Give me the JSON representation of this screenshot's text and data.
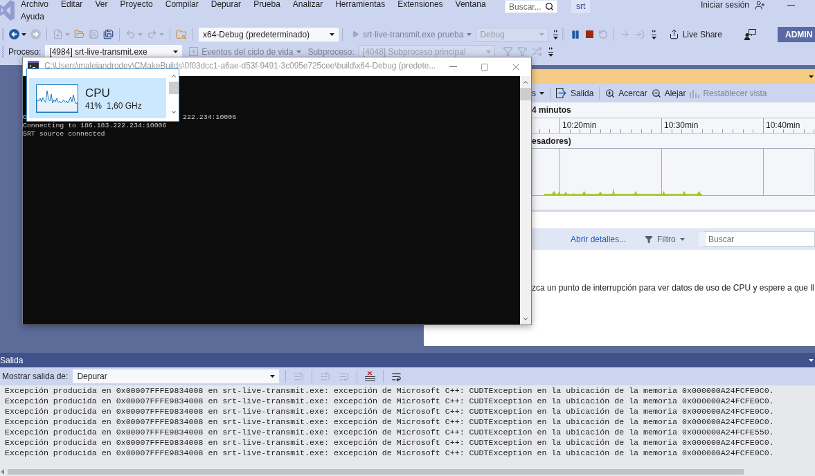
{
  "menu": [
    "Archivo",
    "Editar",
    "Ver",
    "Proyecto",
    "Compilar",
    "Depurar",
    "Prueba",
    "Analizar",
    "Herramientas",
    "Extensiones",
    "Ventana",
    "Ayuda"
  ],
  "search": {
    "placeholder": "Buscar..."
  },
  "solution": "srt",
  "sign_in": "Iniciar sesión",
  "toolbar": {
    "history_buttons": [
      {
        "disabled": false
      },
      {
        "disabled": true
      }
    ],
    "file_buttons": [
      {
        "disabled": true
      },
      {
        "disabled": false
      },
      {
        "disabled": true
      },
      {
        "disabled": false
      }
    ],
    "edit_buttons": [
      {
        "disabled": true
      },
      {
        "disabled": true
      }
    ],
    "configuration": "x64-Debug (predeterminado)",
    "start_button": {
      "label": "srt-live-transmit.exe prueba",
      "disabled": true
    },
    "build_configuration": {
      "value": "Debug",
      "disabled": true
    },
    "debug_buttons": [
      {
        "disabled": false
      },
      {
        "disabled": false
      },
      {
        "disabled": true
      }
    ],
    "step_buttons": [
      {
        "disabled": true
      },
      {
        "disabled": true
      }
    ],
    "live_share": "Live Share",
    "account": "ADMIN"
  },
  "debug_location": {
    "process_label": "Proceso:",
    "process": "[4984] srt-live-transmit.exe",
    "lifecycle_events": {
      "label": "Eventos del ciclo de vida",
      "disabled": true
    },
    "thread_label": "Subproceso:",
    "thread": {
      "value": "[4048] Subproceso principal",
      "disabled": true
    },
    "filter_buttons": [
      {
        "disabled": true
      },
      {
        "disabled": true
      },
      {
        "disabled": true
      }
    ]
  },
  "console_window": {
    "title": "C:\\Users\\malejandrodev\\CMakeBuilds\\0f03dcc1-a6ae-d53f-9491-3c095e725cee\\build\\x64-Debug (predete...",
    "lines": [
      [
        "O",
        "222.234:10006"
      ],
      [
        "Connecting to 186.183.222.234:10006"
      ],
      [
        "SRT source connected"
      ]
    ]
  },
  "performance_popup": {
    "items": [
      {
        "name": "CPU",
        "usage": "41%",
        "speed": "1,60 GHz",
        "selected": true
      }
    ]
  },
  "diagnostics": {
    "toolbar": {
      "tools_menu": "s",
      "output": "Salida",
      "zoom_in": "Acercar",
      "zoom_out": "Alejar",
      "reset_view": {
        "label": "Restablecer vista",
        "disabled": true
      }
    },
    "duration": "4 minutos",
    "timeline_ticks": [
      "10:20min",
      "10:30min",
      "10:40min"
    ],
    "cpu_title": "esadores)",
    "details_link": "Abrir detalles...",
    "filter": "Filtro",
    "search": {
      "placeholder": "Buscar"
    },
    "message": "zca un punto de interrupción para ver datos de uso de CPU y espere a que ll"
  },
  "output": {
    "title": "Salida",
    "show_from_label": "Mostrar salida de:",
    "source": "Depurar",
    "buttons": [
      {
        "disabled": true
      },
      {
        "disabled": true
      },
      {
        "disabled": true
      },
      {
        "disabled": false
      },
      {
        "disabled": false
      }
    ],
    "lines": [
      "Excepción producida en 0x00007FFFE9834008 en srt-live-transmit.exe: excepción de Microsoft C++: CUDTException en la ubicación de la memoria 0x000000A24FCFE0C0.",
      "Excepción producida en 0x00007FFFE9834008 en srt-live-transmit.exe: excepción de Microsoft C++: CUDTException en la ubicación de la memoria 0x000000A24FCFE0C0.",
      "Excepción producida en 0x00007FFFE9834008 en srt-live-transmit.exe: excepción de Microsoft C++: CUDTException en la ubicación de la memoria 0x000000A24FCFE0C0.",
      "Excepción producida en 0x00007FFFE9834008 en srt-live-transmit.exe: excepción de Microsoft C++: CUDTException en la ubicación de la memoria 0x000000A24FCFE0C0.",
      "Excepción producida en 0x00007FFFE9834008 en srt-live-transmit.exe: excepción de Microsoft C++: CUDTException en la ubicación de la memoria 0x000000A24FCFE550.",
      "Excepción producida en 0x00007FFFE9834008 en srt-live-transmit.exe: excepción de Microsoft C++: CUDTException en la ubicación de la memoria 0x000000A24FCFE0C0.",
      "Excepción producida en 0x00007FFFE9834008 en srt-live-transmit.exe: excepción de Microsoft C++: CUDTException en la ubicación de la memoria 0x000000A24FCFE0C0."
    ]
  }
}
